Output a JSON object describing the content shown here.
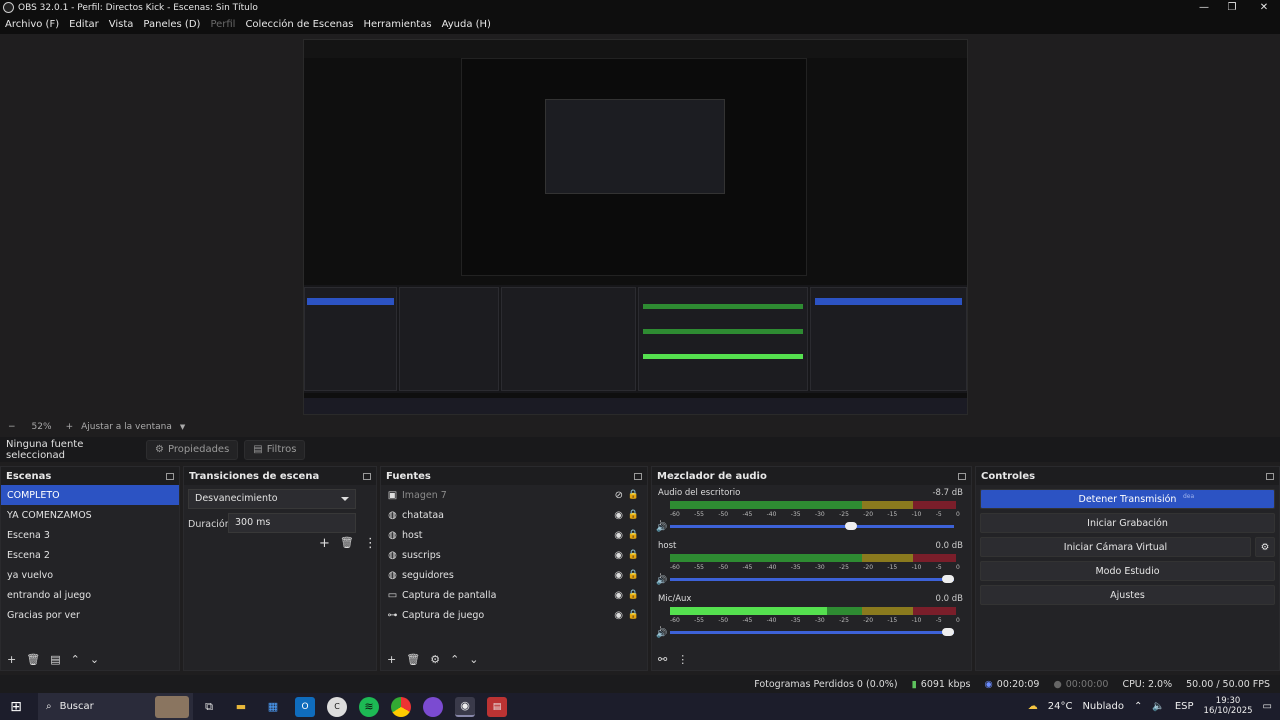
{
  "window": {
    "title": "OBS 32.0.1 - Perfil: Directos Kick - Escenas: Sin Título",
    "minimize": "—",
    "maximize": "❐",
    "close": "✕"
  },
  "menu": [
    "Archivo (F)",
    "Editar",
    "Vista",
    "Paneles (D)",
    "Perfil",
    "Colección de Escenas",
    "Herramientas",
    "Ayuda (H)"
  ],
  "zoom": {
    "minus": "−",
    "level": "52%",
    "plus": "+",
    "fit_label": "Ajustar a la ventana"
  },
  "source_toolbar": {
    "no_source": "Ninguna fuente seleccionad",
    "properties": "Propiedades",
    "filters": "Filtros"
  },
  "scenes": {
    "title": "Escenas",
    "items": [
      "COMPLETO",
      "YA COMENZAMOS",
      "Escena 3",
      "Escena 2",
      "ya vuelvo",
      "entrando al juego",
      "Gracias por ver"
    ],
    "selected_index": 0
  },
  "transitions": {
    "title": "Transiciones de escena",
    "selected": "Desvanecimiento",
    "duration_label": "Duración",
    "duration_value": "300 ms"
  },
  "sources": {
    "title": "Fuentes",
    "items": [
      {
        "name": "Imagen 7",
        "icon": "image-icon",
        "visible": false
      },
      {
        "name": "chatataa",
        "icon": "globe-icon",
        "visible": true
      },
      {
        "name": "host",
        "icon": "globe-icon",
        "visible": true
      },
      {
        "name": "suscrips",
        "icon": "globe-icon",
        "visible": true
      },
      {
        "name": "seguidores",
        "icon": "globe-icon",
        "visible": true
      },
      {
        "name": "Captura de pantalla",
        "icon": "monitor-icon",
        "visible": true
      },
      {
        "name": "Captura de juego",
        "icon": "gamepad-icon",
        "visible": true
      }
    ]
  },
  "mixer": {
    "title": "Mezclador de audio",
    "ticks": [
      "-60",
      "-55",
      "-50",
      "-45",
      "-40",
      "-35",
      "-30",
      "-25",
      "-20",
      "-15",
      "-10",
      "-5",
      "0"
    ],
    "channels": [
      {
        "name": "Audio del escritorio",
        "db": "-8.7 dB",
        "level": 0.0,
        "volume": 0.66
      },
      {
        "name": "host",
        "db": "0.0 dB",
        "level": 0.0,
        "volume": 1.0
      },
      {
        "name": "Mic/Aux",
        "db": "0.0 dB",
        "level": 0.55,
        "volume": 1.0
      }
    ]
  },
  "controls": {
    "title": "Controles",
    "stop_stream": "Detener Transmisión",
    "stop_stream_hint": "dea",
    "start_recording": "Iniciar Grabación",
    "start_virtual_cam": "Iniciar Cámara Virtual",
    "studio_mode": "Modo Estudio",
    "settings": "Ajustes"
  },
  "status": {
    "dropped_frames": "Fotogramas Perdidos 0 (0.0%)",
    "bitrate": "6091 kbps",
    "stream_time": "00:20:09",
    "record_time": "00:00:00",
    "cpu": "CPU: 2.0%",
    "fps": "50.00 / 50.00 FPS"
  },
  "taskbar": {
    "search": "Buscar",
    "weather": "24°C",
    "weather_desc": "Nublado",
    "language": "ESP",
    "time": "19:30",
    "date": "16/10/2025"
  },
  "colors": {
    "accent": "#2c53c3",
    "meter_green": "#2e8b32",
    "meter_yellow": "#8a7a1e",
    "meter_red": "#7a1e2a"
  }
}
